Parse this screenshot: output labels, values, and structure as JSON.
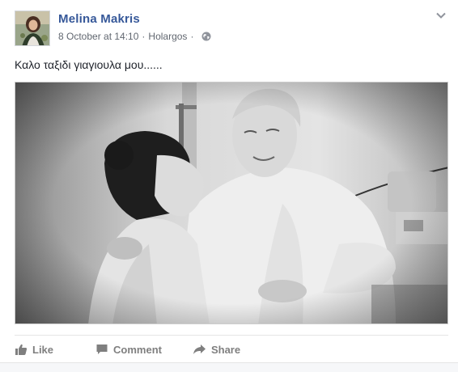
{
  "post": {
    "author": "Melina Makris",
    "timestamp": "8 October at 14:10",
    "separator": "·",
    "location": "Holargos",
    "privacy_icon": "globe-icon",
    "caption": "Καλο ταξιδι γιαγιουλα μου......",
    "photo_description_icon": "photo"
  },
  "actions": {
    "like_label": "Like",
    "comment_label": "Comment",
    "share_label": "Share"
  },
  "colors": {
    "author_link": "#365899",
    "meta_text": "#616770",
    "action_text": "#7f7f7f"
  }
}
